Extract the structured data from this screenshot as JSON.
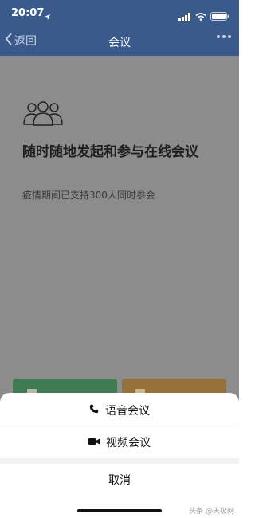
{
  "status_bar": {
    "time": "20:07"
  },
  "nav": {
    "back_label": "返回",
    "title": "会议"
  },
  "hero": {
    "headline": "随时随地发起和参与在线会议",
    "subtitle": "疫情期间已支持300人同时参会"
  },
  "action_sheet": {
    "voice_label": "语音会议",
    "video_label": "视频会议",
    "cancel_label": "取消"
  },
  "watermark": "头条 @天极网",
  "colors": {
    "nav_bg": "#3a5a8c",
    "overlay_bg": "#8c8c8c",
    "green_button": "#3f7a52",
    "orange_button": "#98703a"
  },
  "icons": [
    "location-arrow-icon",
    "signal-icon",
    "wifi-icon",
    "battery-icon",
    "back-chevron-icon",
    "more-icon",
    "people-icon",
    "phone-icon",
    "video-camera-icon"
  ]
}
